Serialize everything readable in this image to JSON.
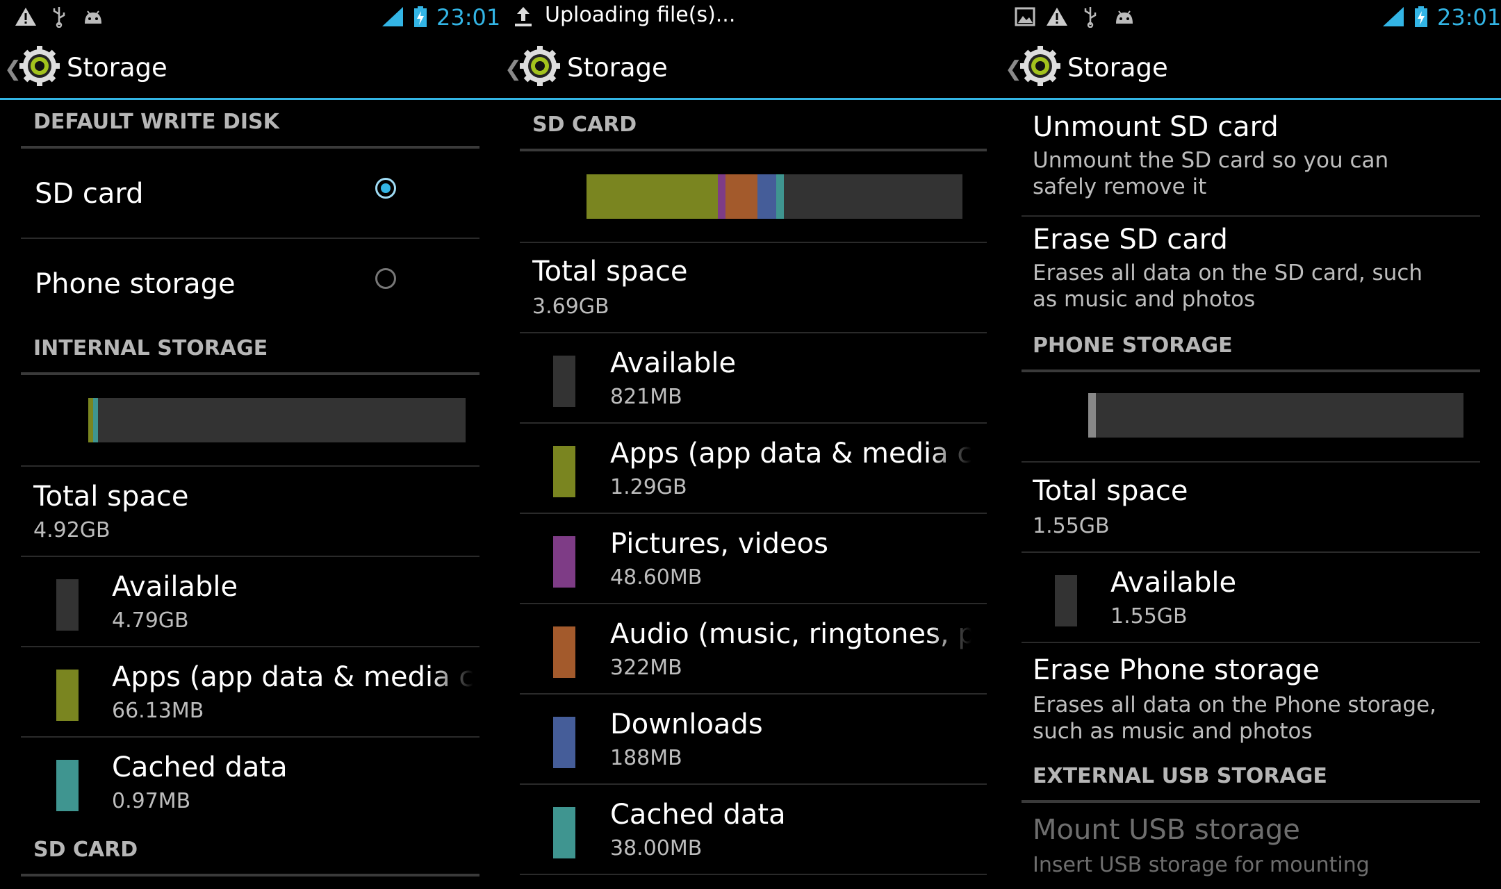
{
  "colors": {
    "accent": "#33b5e5",
    "available": "#333333",
    "apps": "#7a8520",
    "pictures": "#7e3c86",
    "audio": "#a35a2c",
    "downloads": "#455d99",
    "cached": "#3f9590",
    "other": "#888888"
  },
  "status": {
    "time": "23:01",
    "uploading_text": "Uploading file(s)...",
    "icons": [
      "warning-icon",
      "usb-icon",
      "android-debug-icon",
      "signal-icon",
      "battery-charging-icon",
      "upload-icon",
      "image-icon"
    ]
  },
  "actionbar": {
    "title": "Storage"
  },
  "panel1": {
    "sections": {
      "default_write_disk": "DEFAULT WRITE DISK",
      "internal_storage": "INTERNAL STORAGE",
      "sd_card": "SD CARD"
    },
    "radio": [
      {
        "label": "SD card",
        "selected": true
      },
      {
        "label": "Phone storage",
        "selected": false
      }
    ],
    "usage_bar": [
      {
        "name": "apps",
        "fraction": 0.013
      },
      {
        "name": "cached",
        "fraction": 0.012
      },
      {
        "name": "available",
        "fraction": 0.975
      }
    ],
    "total": {
      "label": "Total space",
      "value": "4.92GB"
    },
    "items": [
      {
        "label": "Available",
        "value": "4.79GB",
        "color": "#333333"
      },
      {
        "label": "Apps (app data & media content)",
        "value": "66.13MB",
        "color": "#7a8520"
      },
      {
        "label": "Cached data",
        "value": "0.97MB",
        "color": "#3f9590"
      }
    ]
  },
  "panel2": {
    "section": "SD CARD",
    "usage_bar": [
      {
        "name": "apps",
        "fraction": 0.35
      },
      {
        "name": "pictures",
        "fraction": 0.02
      },
      {
        "name": "audio",
        "fraction": 0.085
      },
      {
        "name": "downloads",
        "fraction": 0.05
      },
      {
        "name": "cached",
        "fraction": 0.02
      },
      {
        "name": "available",
        "fraction": 0.475
      }
    ],
    "total": {
      "label": "Total space",
      "value": "3.69GB"
    },
    "items": [
      {
        "label": "Available",
        "value": "821MB",
        "color": "#333333"
      },
      {
        "label": "Apps (app data & media content)",
        "value": "1.29GB",
        "color": "#7a8520"
      },
      {
        "label": "Pictures, videos",
        "value": "48.60MB",
        "color": "#7e3c86"
      },
      {
        "label": "Audio (music, ringtones, podcasts, etc.)",
        "value": "322MB",
        "color": "#a35a2c"
      },
      {
        "label": "Downloads",
        "value": "188MB",
        "color": "#455d99"
      },
      {
        "label": "Cached data",
        "value": "38.00MB",
        "color": "#3f9590"
      }
    ]
  },
  "panel3": {
    "unmount": {
      "title": "Unmount SD card",
      "summary": "Unmount the SD card so you can safely remove it"
    },
    "erase_sd": {
      "title": "Erase SD card",
      "summary": "Erases all data on the SD card, such as music and photos"
    },
    "phone_section": "PHONE STORAGE",
    "usage_bar": [
      {
        "name": "other",
        "fraction": 0.02
      },
      {
        "name": "available",
        "fraction": 0.98
      }
    ],
    "total": {
      "label": "Total space",
      "value": "1.55GB"
    },
    "available": {
      "label": "Available",
      "value": "1.55GB",
      "color": "#333333"
    },
    "erase_phone": {
      "title": "Erase Phone storage",
      "summary": "Erases all data on the Phone storage, such as music and photos"
    },
    "usb_section": "EXTERNAL USB STORAGE",
    "mount_usb": {
      "title": "Mount USB storage",
      "summary": "Insert USB storage for mounting",
      "enabled": false
    }
  }
}
